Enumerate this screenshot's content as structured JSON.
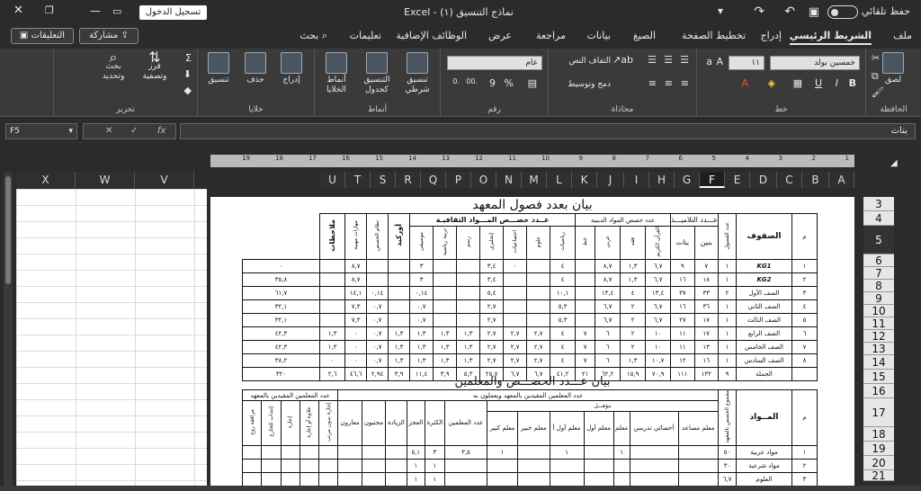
{
  "titlebar": {
    "autosave": "حفظ تلقائي",
    "doc_title": "نماذج التنسيق (١) - Excel",
    "signin": "تسجيل الدخول"
  },
  "tabs": [
    "ملف",
    "الشريط الرئيسي",
    "إدراج",
    "تخطيط الصفحة",
    "الصيغ",
    "بيانات",
    "مراجعة",
    "عرض",
    "الوظائف الإضافية",
    "تعليمات",
    "بحث"
  ],
  "actions": {
    "comments": "التعليقات",
    "share": "مشاركة"
  },
  "ribbon": {
    "clipboard": {
      "label": "الحافظة",
      "paste": "لصق"
    },
    "font": {
      "label": "خط",
      "name": "خمسين بولد",
      "size": "١١",
      "bold": "B",
      "italic": "I",
      "underline": "U"
    },
    "alignment": {
      "label": "محاذاة",
      "wrap": "التفاف النص",
      "merge": "دمج وتوسيط"
    },
    "number": {
      "label": "رقم",
      "format": "عام"
    },
    "styles": {
      "label": "أنماط",
      "conditional": "تنسيق شرطي",
      "table": "التنسيق كجدول",
      "cell": "أنماط الخلايا"
    },
    "cells": {
      "label": "خلايا",
      "insert": "إدراج",
      "delete": "حذف",
      "format": "تنسيق"
    },
    "editing": {
      "label": "تحرير",
      "sort": "فرز وتصفية",
      "find": "بحث وتحديد"
    }
  },
  "formula": {
    "namebox": "F5",
    "fx": "fx",
    "content": "بنات"
  },
  "columns": [
    "A",
    "B",
    "C",
    "D",
    "E",
    "F",
    "G",
    "H",
    "I",
    "J",
    "K",
    "L",
    "M",
    "N",
    "O",
    "P",
    "Q",
    "R",
    "S",
    "T",
    "U",
    "V",
    "W",
    "X"
  ],
  "active_column": "F",
  "rows": [
    "3",
    "4",
    "5",
    "6",
    "7",
    "8",
    "9",
    "10",
    "11",
    "12",
    "13",
    "14",
    "15",
    "16",
    "17",
    "18",
    "19",
    "20",
    "21"
  ],
  "active_row": "5",
  "ruler": [
    "1",
    "2",
    "3",
    "4",
    "5",
    "6",
    "7",
    "8",
    "9",
    "10",
    "11",
    "12",
    "13",
    "14",
    "15",
    "16",
    "17",
    "18",
    "19"
  ],
  "doc": {
    "title1": "بيان بعدد فصول المعهد",
    "t1": {
      "h_num": "م",
      "h_grade": "الصفوف",
      "h_classes": "عدد الفصول",
      "h_students": "عـــدد التلاميـــذ",
      "h_boys": "بنين",
      "h_girls": "بنات",
      "h_religious": "عدد حصص المواد الدينية",
      "h_cultural": "عــدد حصـــص المـــواد الثقافيـة",
      "sub_religious": [
        "القرآن الكريم",
        "فقه",
        "عربي",
        "خط"
      ],
      "sub_cultural": [
        "رياضيات",
        "علوم",
        "اجتماعيات",
        "إنجليزي",
        "رسم",
        "تربية رياضية",
        "موسيقى"
      ],
      "h_total": "أوركيد",
      "h_skills": "مهارات مهنية",
      "h_extra": "نظام الحصص",
      "h_notes": "ملاحظات",
      "rows": [
        [
          "١",
          "KG1",
          "١",
          "٧",
          "٩",
          "٦,٧",
          "١,٣",
          "٨,٧",
          "",
          "٤",
          "",
          "٠",
          "٣,٤",
          "",
          "",
          "٣",
          "",
          "",
          "٨,٧",
          "",
          "٠"
        ],
        [
          "٢",
          "KG2",
          "١",
          "١٨",
          "١٦",
          "٦,٧",
          "١,٣",
          "٨,٧",
          "",
          "٤",
          "",
          "",
          "٣,٤",
          "",
          "",
          "٣",
          "",
          "",
          "٨,٧",
          "",
          "٣٥,٨"
        ],
        [
          "٣",
          "الصف الأول",
          "٢",
          "٣٣",
          "٣٧",
          "١٣,٤",
          "٤",
          "١٣,٤",
          "",
          "١٠,١",
          "",
          "",
          "٥,٤",
          "",
          "",
          "٠,١٤",
          "",
          "٠,١٤",
          "١٤,١",
          "",
          "٦١,٧"
        ],
        [
          "٤",
          "الصف الثاني",
          "١",
          "٣٦",
          "١٦",
          "٦,٧",
          "٢",
          "٦,٧",
          "",
          "٥,٣",
          "",
          "",
          "٢,٧",
          "",
          "",
          "٠,٧",
          "",
          "٠,٧",
          "٧,٣",
          "",
          "٣٢,١"
        ],
        [
          "٥",
          "الصف الثالث",
          "١",
          "١٧",
          "٢٧",
          "٦,٧",
          "٢",
          "٦,٧",
          "",
          "٥,٣",
          "",
          "",
          "٢,٧",
          "",
          "",
          "٠,٧",
          "",
          "٠,٧",
          "٧,٣",
          "",
          "٣٢,١"
        ],
        [
          "٦",
          "الصف الرابع",
          "١",
          "١٧",
          "١١",
          "١٠",
          "٢",
          "٦",
          "٧",
          "٤",
          "٢,٧",
          "٢,٧",
          "٢,٧",
          "١,٣",
          "١,٣",
          "١,٣",
          "١,٣",
          "٠,٧",
          "٠",
          "١,٣",
          "٤٢,٣"
        ],
        [
          "٧",
          "الصف الخامس",
          "١",
          "١٣",
          "١١",
          "١٠",
          "٢",
          "٦",
          "٧",
          "٤",
          "٢,٧",
          "٢,٧",
          "٢,٧",
          "١,٣",
          "١,٣",
          "١,٣",
          "١,٣",
          "٠,٧",
          "٠",
          "١,٣",
          "٤٢,٣"
        ],
        [
          "٨",
          "الصف السادس",
          "١",
          "١٦",
          "١٢",
          "١٠,٧",
          "١,٣",
          "٦",
          "٧",
          "٤",
          "٢,٧",
          "٢,٧",
          "٢,٧",
          "١,٣",
          "١,٣",
          "١,٣",
          "١,٣",
          "٠,٧",
          "٠",
          "٠",
          "٣٨,٢"
        ],
        [
          "",
          "الجملة",
          "٩",
          "١٣٢",
          "١١١",
          "٧٠,٩",
          "١٥,٩",
          "٦٢,٢",
          "٢١",
          "٤١,٢",
          "٦,٧",
          "٦,٧",
          "٢٥,٧",
          "٥,٣",
          "٣,٩",
          "١١,٤",
          "٣,٩",
          "٢,٩٤",
          "٤٦,٦",
          "٢,٦",
          "٣٢٠"
        ]
      ]
    },
    "title2": "بيان عـــدد الحصـــص والمعلمين",
    "t2": {
      "h_num": "م",
      "h_subjects": "المــواد",
      "h_periods": "مجموع الحصص بالمعهد",
      "h_qualified": "عدد المعلمين المقيدين بالمعهد ويعملون به",
      "h_group": "مؤهـــل",
      "sub_qualified": [
        "معلم مساعد",
        "أخصائي تدريس",
        "معلم",
        "معلم أول",
        "معلم أول أ",
        "معلم خبير",
        "معلم كبير",
        "عدد المعلمين",
        "الكثرة",
        "العجز",
        "الزيادة",
        "مجتبون",
        "معارون"
      ],
      "h_unregistered": "عدد المعلمين المقيدين بالمعهد",
      "sub_unregistered": [
        "إجازة بدون مرتب",
        "علاوة أو إعارة",
        "إعارة",
        "إنتداب للخارج",
        "مرافقة زوج"
      ],
      "rows": [
        [
          "١",
          "مواد عربية",
          "٥٠",
          "",
          "",
          "١",
          "",
          "١",
          "",
          "١",
          "٣,٥",
          "٣",
          "٥,١",
          "",
          "",
          ""
        ],
        [
          "٢",
          "مواد شرعية",
          "٣٠",
          "",
          "",
          "",
          "",
          "",
          "",
          "",
          "",
          "١",
          "١",
          "",
          "",
          ""
        ],
        [
          "٣",
          "العلوم",
          "٦,٧",
          "",
          "",
          "",
          "",
          "",
          "",
          "",
          "",
          "١",
          "١",
          "",
          "",
          ""
        ]
      ]
    }
  }
}
